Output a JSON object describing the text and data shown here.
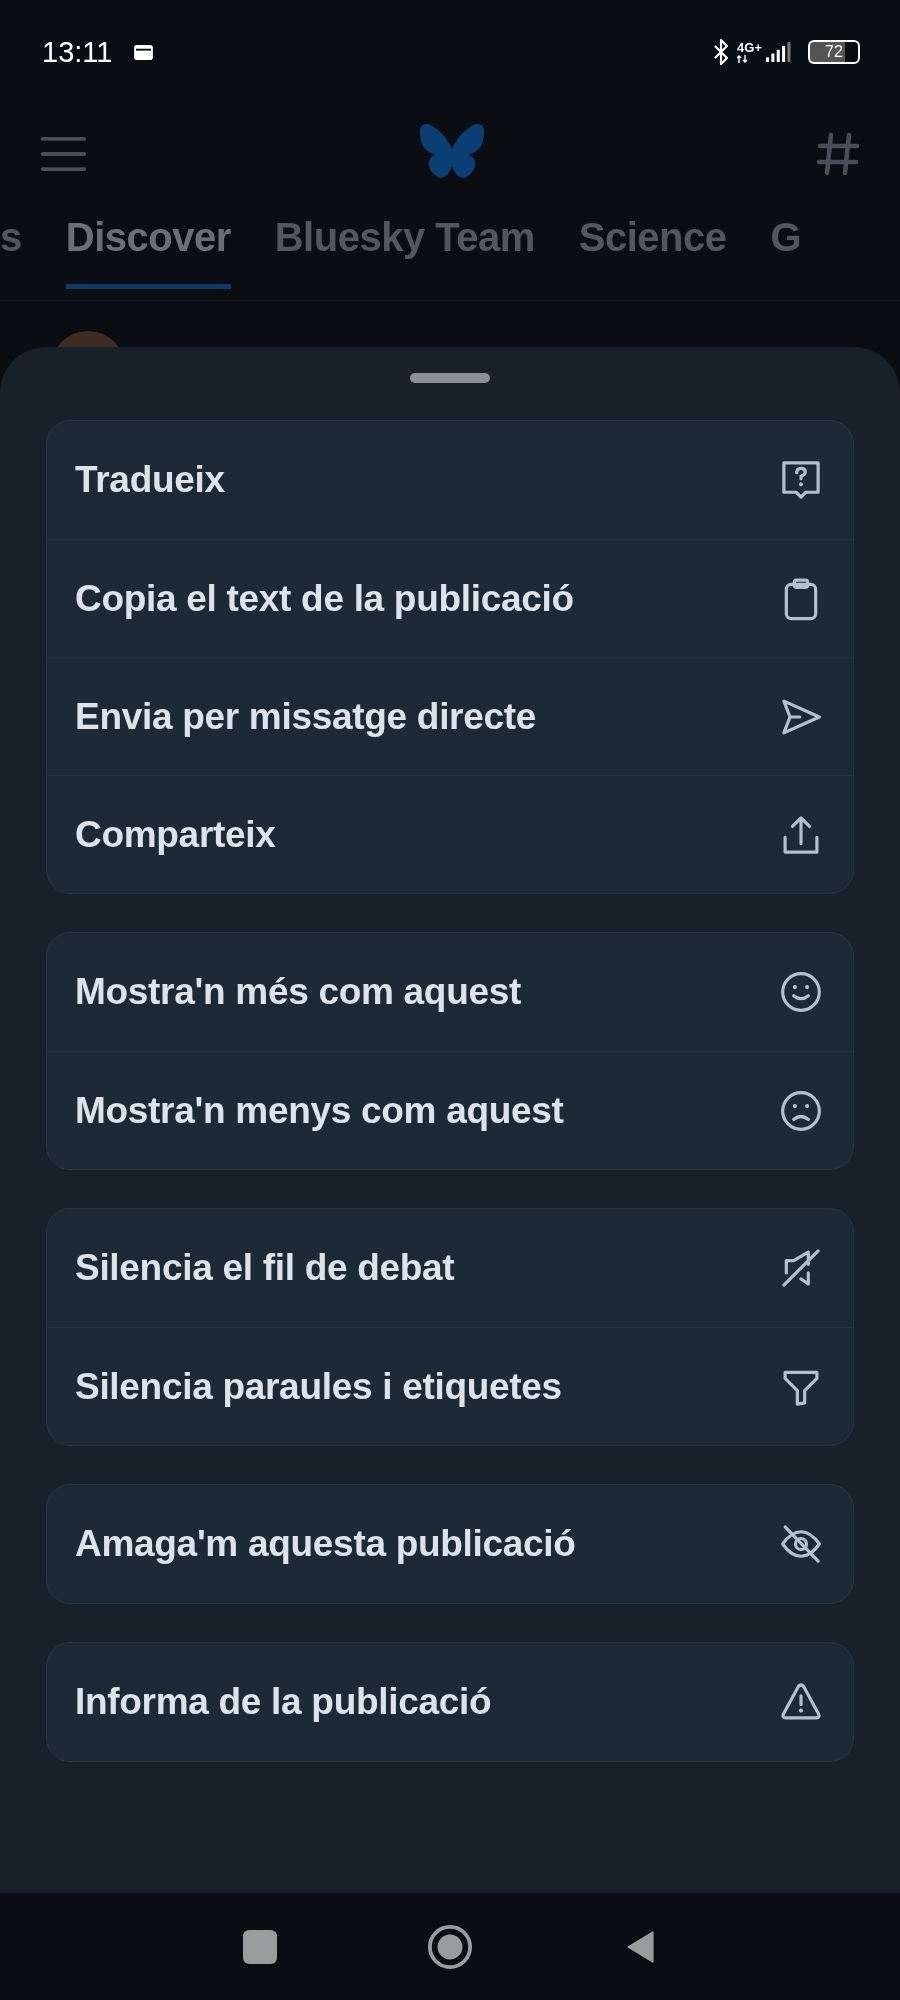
{
  "status_bar": {
    "time": "13:11",
    "network": "4G+",
    "battery": "72"
  },
  "tabs": [
    {
      "label": "s",
      "selected": false
    },
    {
      "label": "Discover",
      "selected": true
    },
    {
      "label": "Bluesky Team",
      "selected": false
    },
    {
      "label": "Science",
      "selected": false
    },
    {
      "label": "G",
      "selected": false
    }
  ],
  "sheet": {
    "groups": [
      {
        "items": [
          {
            "label": "Tradueix",
            "kind": "translate"
          },
          {
            "label": "Copia el text de la publicació",
            "kind": "copy"
          },
          {
            "label": "Envia per missatge directe",
            "kind": "send"
          },
          {
            "label": "Comparteix",
            "kind": "share"
          }
        ]
      },
      {
        "items": [
          {
            "label": "Mostra'n més com aquest",
            "kind": "more"
          },
          {
            "label": "Mostra'n menys com aquest",
            "kind": "less"
          }
        ]
      },
      {
        "items": [
          {
            "label": "Silencia el fil de debat",
            "kind": "mute"
          },
          {
            "label": "Silencia paraules i etiquetes",
            "kind": "filter"
          }
        ]
      },
      {
        "items": [
          {
            "label": "Amaga'm aquesta publicació",
            "kind": "hide"
          }
        ]
      },
      {
        "items": [
          {
            "label": "Informa de la publicació",
            "kind": "report"
          }
        ]
      }
    ]
  }
}
